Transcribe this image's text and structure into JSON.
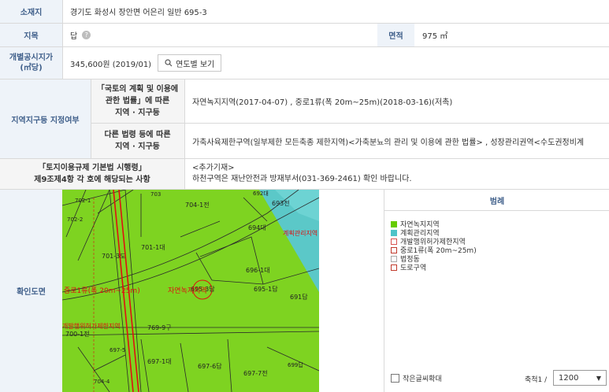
{
  "location": {
    "label": "소재지",
    "value": "경기도 화성시 장안면 어은리 일반 695-3"
  },
  "land": {
    "label": "지목",
    "value": "답",
    "help": "?",
    "area_label": "면적",
    "area_value": "975 ㎡"
  },
  "price": {
    "label_line1": "개별공시지가",
    "label_line2": "(㎡당)",
    "value": "345,600원 (2019/01)",
    "button": "연도별 보기"
  },
  "zone": {
    "label": "지역지구등 지정여부",
    "sub1_line1": "「국토의 계획 및 이용에",
    "sub1_line2": "관한 법률」에 따른",
    "sub1_line3": "지역 · 지구등",
    "value1": "자연녹지지역(2017-04-07) , 중로1류(폭 20m~25m)(2018-03-16)(저촉)",
    "sub2_line1": "다른 법령 등에 따른",
    "sub2_line2": "지역 · 지구등",
    "value2": "가축사육제한구역(일부제한 모든축종 제한지역)<가축분뇨의 관리 및 이용에 관한 법률> , 성장관리권역<수도권정비계"
  },
  "regulation": {
    "label_line1": "「토지이용규제 기본법 시행령」",
    "label_line2": "제9조제4항 각 호에 해당되는 사항",
    "value_line1": "<추가기재>",
    "value_line2": "하천구역은 재난안전과 방재부서(031-369-2461) 확인 바랍니다."
  },
  "map": {
    "label": "확인도면",
    "parcels": [
      "704-1전",
      "693전",
      "694대",
      "701-3도",
      "701-1대",
      "696-1대",
      "695-3답",
      "695-1답",
      "691답",
      "769-9구",
      "700-1전",
      "697-1대",
      "697-6답",
      "697-7전",
      "699답",
      "697-5",
      "702-2",
      "702-1",
      "703",
      "704-4",
      "692대"
    ],
    "overlay": {
      "zone1": "계획관리지역",
      "road": "중로1류(폭 20m~25m)",
      "natural": "자연녹지지역",
      "restrict": "개발행위허가제한지역"
    }
  },
  "legend": {
    "title": "범례",
    "items": [
      {
        "label": "자연녹지지역",
        "color": "#66cc00",
        "type": "fill"
      },
      {
        "label": "계획관리지역",
        "color": "#4fc3c8",
        "type": "fill"
      },
      {
        "label": "개발행위허가제한지역",
        "color": "#d9534f",
        "type": "outline"
      },
      {
        "label": "중로1류(폭 20m~25m)",
        "color": "#c0392b",
        "type": "outline"
      },
      {
        "label": "법정동",
        "color": "#aaaaaa",
        "type": "outline"
      },
      {
        "label": "도로구역",
        "color": "#c0392b",
        "type": "outline"
      }
    ],
    "checkbox_label": "작은글씨확대",
    "scale_label": "축척1 /",
    "scale_value": "1200"
  },
  "colors": {
    "header_bg": "#eef3f9",
    "header_text": "#3f5f8a",
    "border": "#d9d9d9",
    "map_green": "#7ed321",
    "map_cyan": "#5bc8c8"
  }
}
